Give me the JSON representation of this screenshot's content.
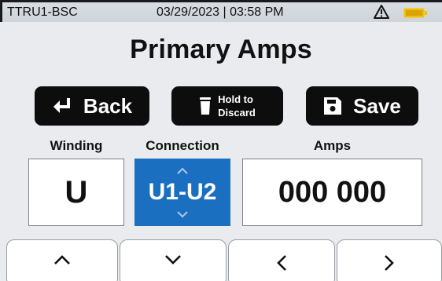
{
  "status_bar": {
    "device_name": "TTRU1-BSC",
    "datetime": "03/29/2023 | 03:58 PM",
    "icons": [
      "warning-icon",
      "battery-icon"
    ],
    "battery_color": "#f2c200"
  },
  "title": "Primary Amps",
  "actions": {
    "back_label": "Back",
    "discard_label_line1": "Hold to",
    "discard_label_line2": "Discard",
    "save_label": "Save"
  },
  "columns": {
    "winding": {
      "label": "Winding",
      "value": "U"
    },
    "connection": {
      "label": "Connection",
      "value": "U1-U2"
    },
    "amps": {
      "label": "Amps",
      "value": "000 000"
    }
  },
  "nav_buttons": [
    "chevron-up-icon",
    "chevron-down-icon",
    "chevron-left-icon",
    "chevron-right-icon"
  ],
  "colors": {
    "accent": "#1b6fc0",
    "button_bg": "#0d0d0d",
    "screen_bg": "#e9ebee"
  }
}
